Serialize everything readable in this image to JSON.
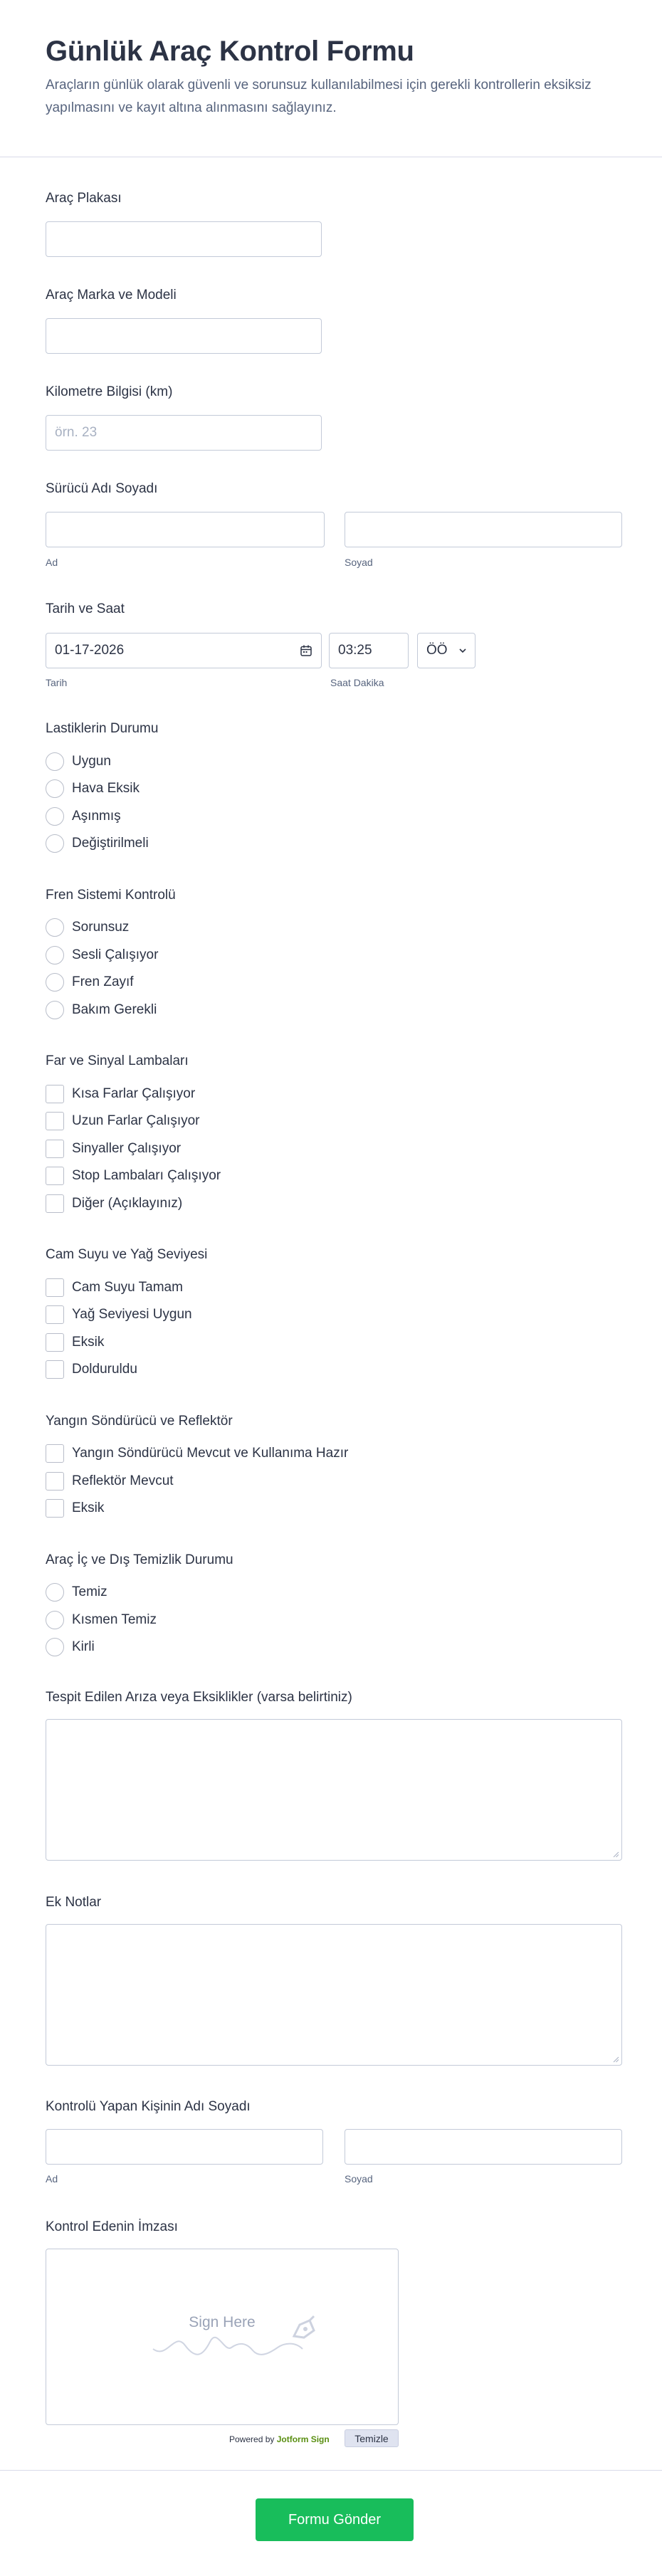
{
  "header": {
    "title": "Günlük Araç Kontrol Formu",
    "subtitle": "Araçların günlük olarak güvenli ve sorunsuz kullanılabilmesi için gerekli kontrollerin eksiksiz yapılmasını ve kayıt altına alınmasını sağlayınız."
  },
  "plate": {
    "label": "Araç Plakası",
    "value": ""
  },
  "make_model": {
    "label": "Araç Marka ve Modeli",
    "value": ""
  },
  "km": {
    "label": "Kilometre Bilgisi (km)",
    "placeholder": "örn. 23",
    "value": ""
  },
  "driver": {
    "label": "Sürücü Adı Soyadı",
    "first_sublabel": "Ad",
    "last_sublabel": "Soyad"
  },
  "datetime": {
    "label": "Tarih ve Saat",
    "date_value": "01-17-2026",
    "time_value": "03:25",
    "ampm_value": "ÖÖ",
    "date_sublabel": "Tarih",
    "time_sublabel": "Saat Dakika"
  },
  "tires": {
    "label": "Lastiklerin Durumu",
    "options": [
      "Uygun",
      "Hava Eksik",
      "Aşınmış",
      "Değiştirilmeli"
    ]
  },
  "brakes": {
    "label": "Fren Sistemi Kontrolü",
    "options": [
      "Sorunsuz",
      "Sesli Çalışıyor",
      "Fren Zayıf",
      "Bakım Gerekli"
    ]
  },
  "lights": {
    "label": "Far ve Sinyal Lambaları",
    "options": [
      "Kısa Farlar Çalışıyor",
      "Uzun Farlar Çalışıyor",
      "Sinyaller Çalışıyor",
      "Stop Lambaları Çalışıyor",
      "Diğer (Açıklayınız)"
    ]
  },
  "fluids": {
    "label": "Cam Suyu ve Yağ Seviyesi",
    "options": [
      "Cam Suyu Tamam",
      "Yağ Seviyesi Uygun",
      "Eksik",
      "Dolduruldu"
    ]
  },
  "safety": {
    "label": "Yangın Söndürücü ve Reflektör",
    "options": [
      "Yangın Söndürücü Mevcut ve Kullanıma Hazır",
      "Reflektör Mevcut",
      "Eksik"
    ]
  },
  "cleanliness": {
    "label": "Araç İç ve Dış Temizlik Durumu",
    "options": [
      "Temiz",
      "Kısmen Temiz",
      "Kirli"
    ]
  },
  "faults": {
    "label": "Tespit Edilen Arıza veya Eksiklikler (varsa belirtiniz)"
  },
  "notes": {
    "label": "Ek Notlar"
  },
  "inspector": {
    "label": "Kontrolü Yapan Kişinin Adı Soyadı",
    "first_sublabel": "Ad",
    "last_sublabel": "Soyad"
  },
  "signature": {
    "label": "Kontrol Edenin İmzası",
    "hint": "Sign Here",
    "powered_prefix": "Powered by",
    "powered_brand": "Jotform Sign",
    "clear_label": "Temizle"
  },
  "submit_label": "Formu Gönder",
  "colors": {
    "submit": "#18bd5b",
    "border": "#c3cad8",
    "text": "#2c3345",
    "muted": "#57647e"
  }
}
